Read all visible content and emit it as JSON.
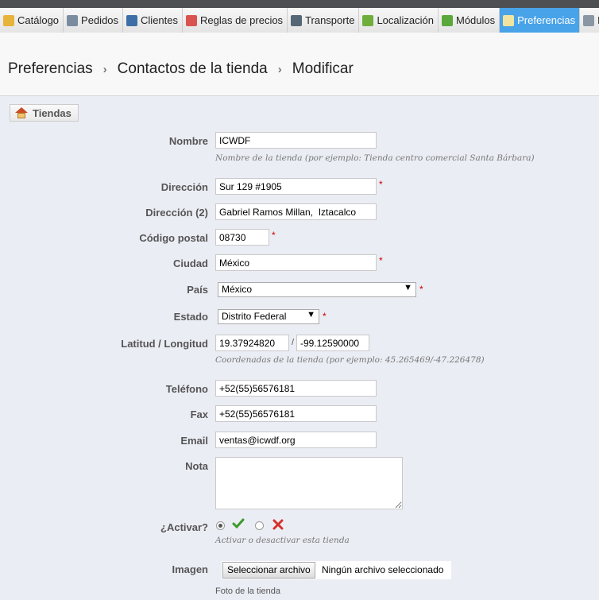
{
  "menu": [
    {
      "label": "Catálogo",
      "icon": "folder-icon",
      "color": "#e8b33a"
    },
    {
      "label": "Pedidos",
      "icon": "cart-icon",
      "color": "#7b8ca0"
    },
    {
      "label": "Clientes",
      "icon": "user-icon",
      "color": "#3d6fa6"
    },
    {
      "label": "Reglas de precios",
      "icon": "price-rules-icon",
      "color": "#d9534f"
    },
    {
      "label": "Transporte",
      "icon": "truck-icon",
      "color": "#556677"
    },
    {
      "label": "Localización",
      "icon": "globe-icon",
      "color": "#6fae3a"
    },
    {
      "label": "Módulos",
      "icon": "puzzle-icon",
      "color": "#5aa83a"
    },
    {
      "label": "Preferencias",
      "icon": "preferences-icon",
      "color": "#f3e3a0",
      "active": true
    },
    {
      "label": "Pa",
      "icon": "wrench-icon",
      "color": "#8a96a3"
    }
  ],
  "breadcrumb": [
    "Preferencias",
    "Contactos de la tienda",
    "Modificar"
  ],
  "breadcrumb_sep": "›",
  "legend": "Tiendas",
  "form": {
    "nombre": {
      "label": "Nombre",
      "value": "ICWDF",
      "hint": "Nombre de la tienda (por ejemplo: Tienda centro comercial Santa Bárbara)"
    },
    "direccion": {
      "label": "Dirección",
      "value": "Sur 129 #1905"
    },
    "direccion2": {
      "label": "Dirección (2)",
      "value": "Gabriel Ramos Millan,  Iztacalco"
    },
    "codigo_postal": {
      "label": "Código postal",
      "value": "08730"
    },
    "ciudad": {
      "label": "Ciudad",
      "value": "México"
    },
    "pais": {
      "label": "País",
      "value": "México"
    },
    "estado": {
      "label": "Estado",
      "value": "Distrito Federal"
    },
    "latlng": {
      "label": "Latitud / Longitud",
      "lat": "19.37924820",
      "lng": "-99.12590000",
      "sep": "/",
      "hint": "Coordenadas de la tienda (por ejemplo: 45.265469/-47.226478)"
    },
    "telefono": {
      "label": "Teléfono",
      "value": "+52(55)56576181"
    },
    "fax": {
      "label": "Fax",
      "value": "+52(55)56576181"
    },
    "email": {
      "label": "Email",
      "value": "ventas@icwdf.org"
    },
    "nota": {
      "label": "Nota",
      "value": ""
    },
    "activar": {
      "label": "¿Activar?",
      "hint": "Activar o desactivar esta tienda"
    },
    "imagen": {
      "label": "Imagen",
      "button": "Seleccionar archivo",
      "file": "Ningún archivo seleccionado",
      "hint": "Foto de la tienda"
    }
  },
  "required_mark": "*",
  "select_arrow": "▼"
}
